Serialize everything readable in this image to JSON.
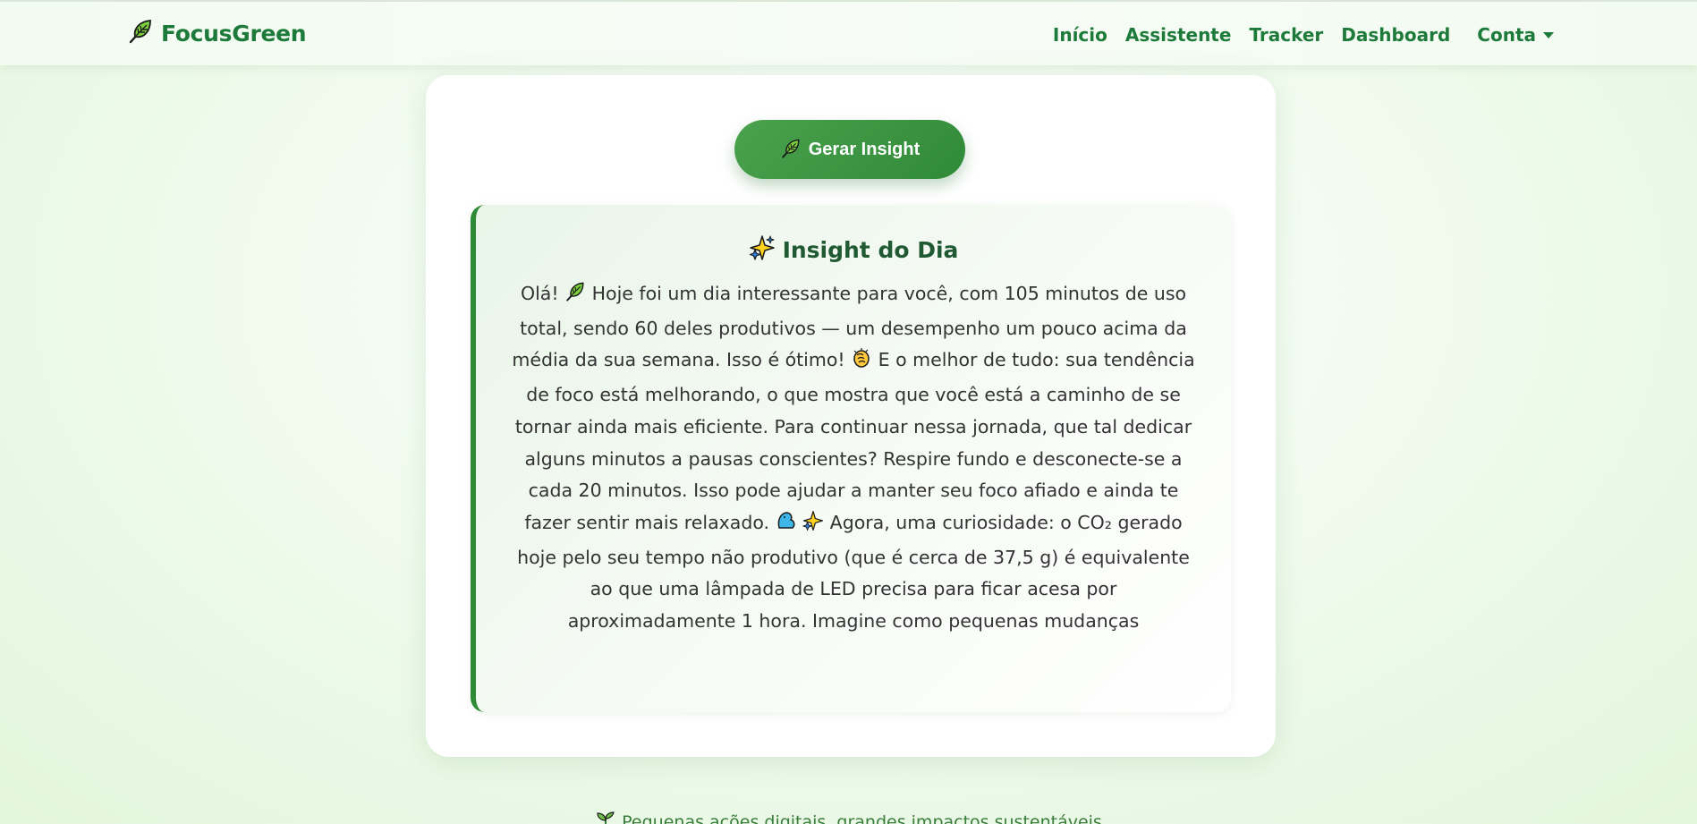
{
  "navbar": {
    "brand": "FocusGreen",
    "brand_icon": "leaf-icon",
    "links": [
      "Início",
      "Assistente",
      "Tracker",
      "Dashboard"
    ],
    "account_label": "Conta"
  },
  "main": {
    "button_label": "Gerar Insight",
    "insight": {
      "title": "Insight do Dia",
      "title_icon": "sparkles-icon",
      "parts": {
        "p1": "Olá!",
        "p2": "Hoje foi um dia interessante para você, com 105 minutos de uso total, sendo 60 deles produtivos — um desempenho um pouco acima da média da sua semana. Isso é ótimo!",
        "p3": "E o melhor de tudo: sua tendência de foco está melhorando, o que mostra que você está a caminho de se tornar ainda mais eficiente. Para continuar nessa jornada, que tal dedicar alguns minutos a pausas conscientes? Respire fundo e desconecte-se a cada 20 minutos. Isso pode ajudar a manter seu foco afiado e ainda te fazer sentir mais relaxado.",
        "p4": "Agora, uma curiosidade: o CO₂ gerado hoje pelo seu tempo não produtivo (que é cerca de 37,5 g) é equivalente ao que uma lâmpada de LED precisa para ficar acesa por aproximadamente 1 hora. Imagine como pequenas mudanças"
      }
    }
  },
  "footer": {
    "text": "Pequenas ações digitais, grandes impactos sustentáveis",
    "icon": "seedling-icon"
  },
  "colors": {
    "brand_green": "#1e7a3a",
    "button_green": "#3a9640",
    "title_green": "#1f5a33"
  }
}
